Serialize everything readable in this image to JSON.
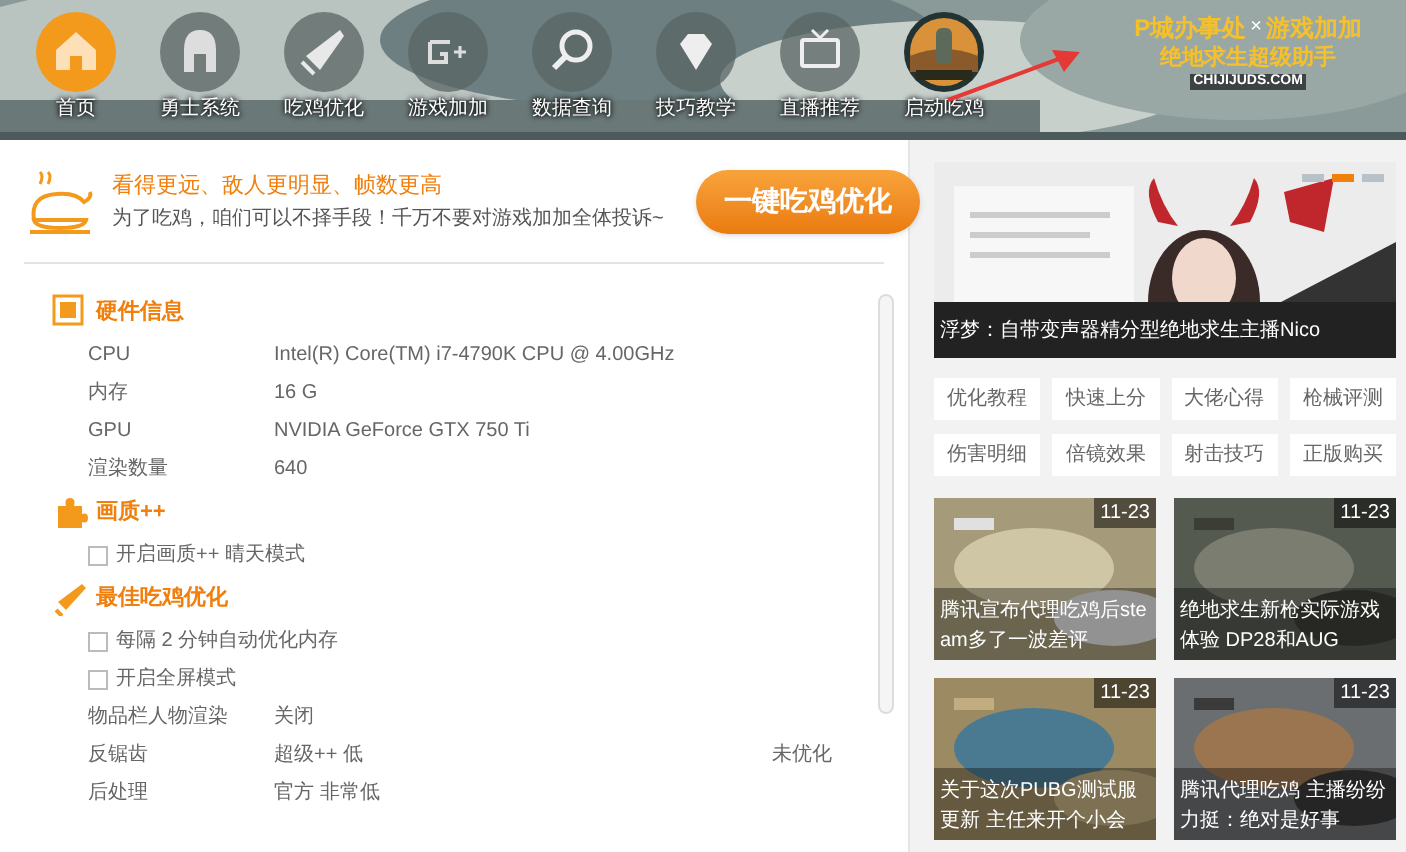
{
  "nav": [
    {
      "label": "首页",
      "selected": true
    },
    {
      "label": "勇士系统",
      "selected": false
    },
    {
      "label": "吃鸡优化",
      "selected": false
    },
    {
      "label": "游戏加加",
      "selected": false
    },
    {
      "label": "数据查询",
      "selected": false
    },
    {
      "label": "技巧教学",
      "selected": false
    },
    {
      "label": "直播推荐",
      "selected": false
    },
    {
      "label": "启动吃鸡",
      "kind": "picture",
      "selected": false
    }
  ],
  "logo": {
    "line_1": "P城办事处",
    "cross": "×",
    "line_1b": "游戏加加",
    "line_2": "绝地求生超级助手",
    "line_3": "CHIJIJUDS.COM"
  },
  "promo": {
    "headline": "看得更远、敌人更明显、帧数更高",
    "subtitle": "为了吃鸡，咱们可以不择手段！千万不要对游戏加加全体投诉~",
    "button": "一键吃鸡优化"
  },
  "sections": [
    {
      "title": "硬件信息",
      "rows": [
        {
          "kind": "info",
          "label": "CPU",
          "value": "Intel(R) Core(TM) i7-4790K CPU @ 4.00GHz"
        },
        {
          "kind": "info",
          "label": "内存",
          "value": "16 G"
        },
        {
          "kind": "info",
          "label": "GPU",
          "value": "NVIDIA GeForce GTX 750 Ti"
        },
        {
          "kind": "info",
          "label": "渲染数量",
          "value": "640"
        }
      ]
    },
    {
      "title": "画质++",
      "rows": [
        {
          "kind": "checkbox",
          "label": "开启画质++ 晴天模式",
          "checked": false
        }
      ]
    },
    {
      "title": "最佳吃鸡优化",
      "rows": [
        {
          "kind": "checkbox",
          "label": "每隔 2 分钟自动优化内存",
          "checked": false
        },
        {
          "kind": "checkbox",
          "label": "开启全屏模式",
          "checked": false
        },
        {
          "kind": "info",
          "label": "物品栏人物渲染",
          "value": "关闭"
        },
        {
          "kind": "info",
          "label": "反锯齿",
          "value": "超级++ 低",
          "status": "未优化"
        },
        {
          "kind": "info",
          "label": "后处理",
          "value": "官方 非常低"
        }
      ]
    }
  ],
  "banner": {
    "caption": "浮梦：自带变声器精分型绝地求生主播Nico",
    "dots": [
      {
        "selected": false
      },
      {
        "selected": true
      },
      {
        "selected": false
      }
    ]
  },
  "tags": [
    "优化教程",
    "快速上分",
    "大佬心得",
    "枪械评测",
    "伤害明细",
    "倍镜效果",
    "射击技巧",
    "正版购买"
  ],
  "articles": [
    {
      "date": "11-23",
      "title": "腾讯宣布代理吃鸡后steam多了一波差评"
    },
    {
      "date": "11-23",
      "title": "绝地求生新枪实际游戏体验 DP28和AUG"
    },
    {
      "date": "11-23",
      "title": "关于这次PUBG测试服更新 主任来开个小会"
    },
    {
      "date": "11-23",
      "title": "腾讯代理吃鸡 主播纷纷力挺：绝对是好事"
    }
  ]
}
